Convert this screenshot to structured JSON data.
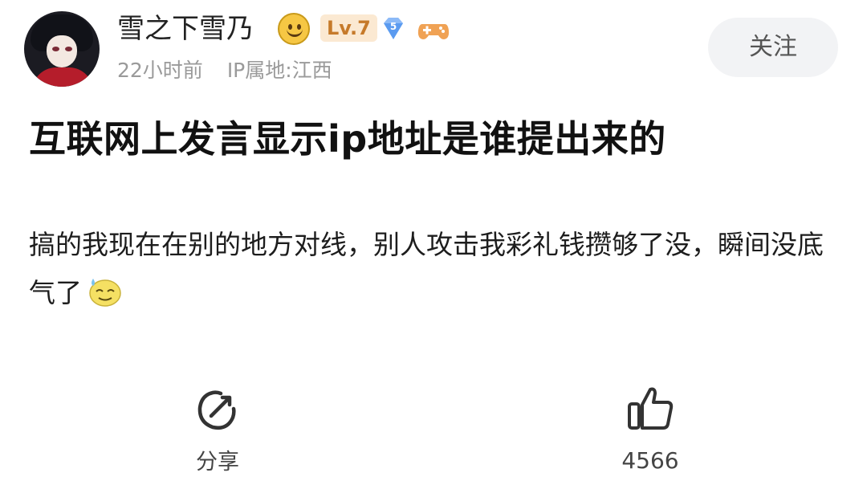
{
  "header": {
    "username": "雪之下雪乃",
    "level": "Lv.7",
    "vip_level": "5",
    "time_ago": "22小时前",
    "ip_location": "IP属地:江西",
    "follow_label": "关注"
  },
  "post": {
    "title": "互联网上发言显示ip地址是谁提出来的",
    "body": "搞的我现在在别的地方对线，别人攻击我彩礼钱攒够了没，瞬间没底气了"
  },
  "actions": {
    "share_label": "分享",
    "like_count": "4566"
  },
  "icons": {
    "avatar": "anime-avatar",
    "name_emoji": "smile-icon",
    "vip": "diamond-icon",
    "game": "gamepad-icon",
    "body_emoji": "sweat-smile-icon",
    "share": "share-icon",
    "like": "thumbs-up-icon"
  },
  "colors": {
    "level_badge_bg": "#fbe9d2",
    "level_badge_text": "#c67a2a",
    "vip_blue": "#5b9bf0",
    "game_orange": "#f0a254",
    "follow_bg": "#f2f3f5",
    "meta_gray": "#9a9a9a"
  }
}
